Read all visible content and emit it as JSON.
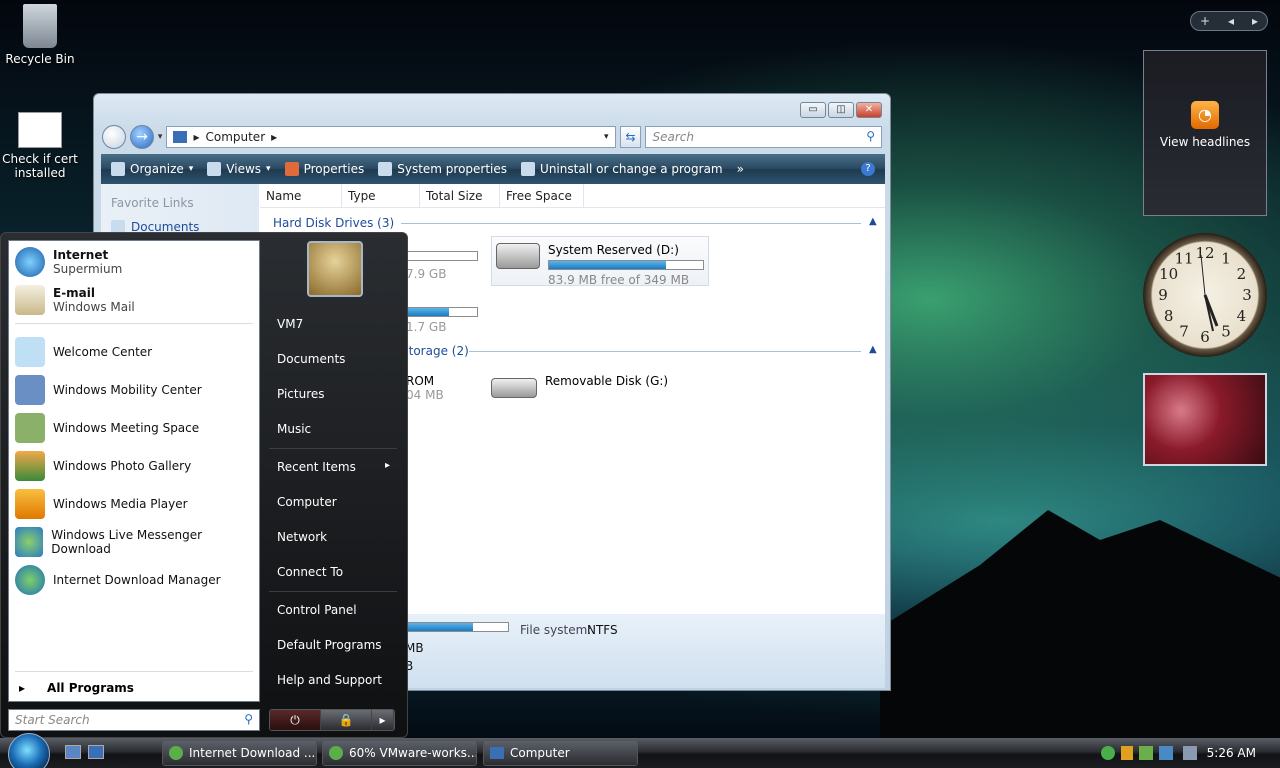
{
  "desktop": {
    "icons": [
      {
        "label": "Recycle Bin"
      },
      {
        "label": "Check if cert installed"
      }
    ]
  },
  "explorer": {
    "title_buttons": [
      "▭",
      "◫",
      "✕"
    ],
    "address": {
      "crumb": "Computer"
    },
    "search": {
      "placeholder": "Search"
    },
    "toolbar": {
      "organize": "Organize",
      "views": "Views",
      "properties": "Properties",
      "system_properties": "System properties",
      "uninstall": "Uninstall or change a program",
      "more": "»"
    },
    "favorite_links": {
      "header": "Favorite Links",
      "item": "Documents"
    },
    "columns": [
      "Name",
      "Type",
      "Total Size",
      "Free Space"
    ],
    "groups": {
      "hdd": "Hard Disk Drives (3)",
      "removable": "Storage (2)"
    },
    "drives": {
      "partial1": "7.9 GB",
      "partial2": "1.7 GB",
      "sysres_name": "System Reserved (D:)",
      "sysres_free": "83.9 MB free of 349 MB",
      "sysres_fill": 0.76,
      "rom_label": "ROM",
      "rom_size": "04 MB",
      "removable_name": "Removable Disk (G:)"
    },
    "details": {
      "fs_label": "File system:",
      "fs_value": "NTFS",
      "line2": "MB",
      "line3": "B"
    }
  },
  "start_menu": {
    "pinned": [
      {
        "title": "Internet",
        "sub": "Supermium"
      },
      {
        "title": "E-mail",
        "sub": "Windows Mail"
      }
    ],
    "recent": [
      "Welcome Center",
      "Windows Mobility Center",
      "Windows Meeting Space",
      "Windows Photo Gallery",
      "Windows Media Player",
      "Windows Live Messenger Download",
      "Internet Download Manager"
    ],
    "all_programs": "All Programs",
    "search_placeholder": "Start Search",
    "right": {
      "user": "VM7",
      "documents": "Documents",
      "pictures": "Pictures",
      "music": "Music",
      "recent_items": "Recent Items",
      "computer": "Computer",
      "network": "Network",
      "connect_to": "Connect To",
      "control_panel": "Control Panel",
      "default_programs": "Default Programs",
      "help": "Help and Support"
    },
    "power": {
      "power": "⏻",
      "lock": "🔒",
      "arrow": "▸"
    }
  },
  "gadgets": {
    "feed": "View headlines",
    "clock_numbers": [
      "12",
      "1",
      "2",
      "3",
      "4",
      "5",
      "6",
      "7",
      "8",
      "9",
      "10",
      "11"
    ],
    "sidebar_controls": [
      "+",
      "◂",
      "▸"
    ]
  },
  "taskbar": {
    "buttons": [
      "Internet Download ...",
      "60% VMware-works...",
      "Computer"
    ],
    "time": "5:26 AM"
  }
}
